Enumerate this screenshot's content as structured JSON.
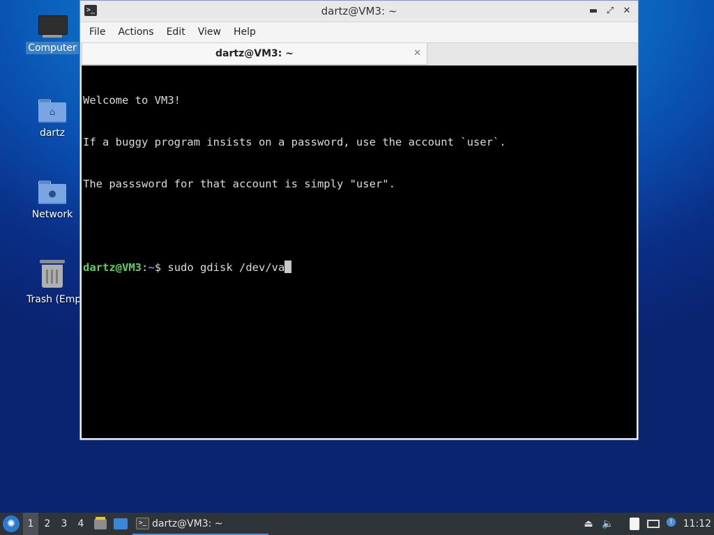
{
  "desktop": {
    "icons": [
      {
        "label": "Computer"
      },
      {
        "label": "dartz"
      },
      {
        "label": "Network"
      },
      {
        "label": "Trash (Empty)"
      }
    ]
  },
  "window": {
    "title": "dartz@VM3: ~",
    "controls": {
      "minimize": "▬",
      "maximize": "⤢",
      "close": "✕"
    },
    "menu": [
      "File",
      "Actions",
      "Edit",
      "View",
      "Help"
    ],
    "tab": {
      "title": "dartz@VM3: ~",
      "close": "✕"
    }
  },
  "terminal": {
    "lines": [
      "Welcome to VM3!",
      "If a buggy program insists on a password, use the account `user`.",
      "The passsword for that account is simply \"user\".",
      ""
    ],
    "prompt": {
      "user": "dartz@VM3",
      "sep": ":",
      "path": "~",
      "symbol": "$ "
    },
    "command": "sudo gdisk /dev/va"
  },
  "taskbar": {
    "workspaces": [
      "1",
      "2",
      "3",
      "4"
    ],
    "active_workspace": "1",
    "task_label": "dartz@VM3: ~",
    "clock": "11:12"
  }
}
